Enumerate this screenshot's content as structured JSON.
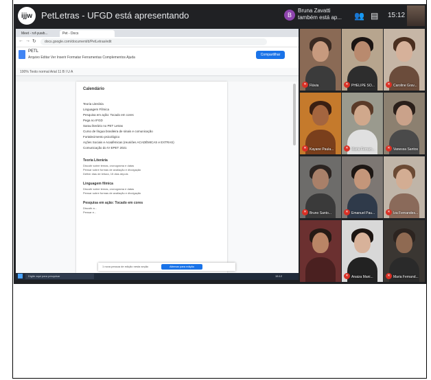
{
  "meet": {
    "logo": "ijjw",
    "title": "PetLetras - UFGD está apresentando",
    "presenter_initial": "B",
    "presenter_line1": "Bruna Zavatti",
    "presenter_line2": "também está ap...",
    "clock": "15:12",
    "icons": [
      "people-icon",
      "chat-icon"
    ]
  },
  "browser": {
    "tabs": [
      "Meet - rvf-yuwb...",
      "Pet - Docs"
    ],
    "url": "docs.google.com/document/d/PetLetras/edit",
    "doc_title": "PETL",
    "menu": "Arquivo  Editar  Ver  Inserir  Formatar  Ferramentas  Complementos  Ajuda",
    "share_label": "Compartilhar",
    "toolbar": "100%   Texto normal   Arial   11   B I U A",
    "doc": {
      "heading": "Calendário",
      "bullets": [
        "Teoria Literária",
        "Linguagem Fílmica",
        "Pesquisa em ação: Tocado em cores",
        "Pega no IFGD",
        "Sarau literário no PET Letras",
        "Curso de língua brasileira de sinais e comunicação",
        "Fortalecimento psicológico",
        "Ações Sociais e Acadêmicas (reuniões ACADÊMICAS e EXTRAS)",
        "Comunicação do IV EPET 2021"
      ],
      "section1": "Teoria Literária",
      "section1_lines": [
        "Discutir sobre temas, cronograma e datas",
        "Pensar sobre formas de avaliação e divulgação",
        "Definir dias de leitura, 15 dias depois"
      ],
      "section2": "Linguagem fílmica",
      "section2_lines": [
        "Discutir sobre temas, cronograma e datas",
        "Pensar sobre formas de avaliação e divulgação"
      ],
      "section3": "Pesquisa em ação: Tocado em cores",
      "section3_lines": [
        "Discutir a...",
        "Pensar e..."
      ]
    },
    "snackbar_text": "1 nova pessoa de edição nesta seção",
    "snackbar_button": "Alternar para edição",
    "taskbar_search": "Digite aqui para pesquisar",
    "taskbar_clock": "15:12"
  },
  "participants": [
    {
      "name": "Flávia",
      "skin": "#c79a7e",
      "hair": "#3a2a22",
      "bg": "#8a6a55",
      "shirt": "#3b3b3b"
    },
    {
      "name": "PHELIPE SO...",
      "skin": "#b98a6e",
      "hair": "#1a1412",
      "bg": "#b7a58e",
      "shirt": "#2d2d2d"
    },
    {
      "name": "Caroline Grav...",
      "skin": "#d6b19a",
      "hair": "#4a2f20",
      "bg": "#c6b6a6",
      "shirt": "#6b4c3b"
    },
    {
      "name": "Kayane Paula...",
      "skin": "#a4653f",
      "hair": "#3a1f12",
      "bg": "#c57a2c",
      "shirt": "#7a3f1c"
    },
    {
      "name": "Maria Fernan...",
      "skin": "#d0a88c",
      "hair": "#5a3a28",
      "bg": "#9a9a8e",
      "shirt": "#e0e0e0"
    },
    {
      "name": "Vanessa Santos",
      "skin": "#caa28a",
      "hair": "#2a1f1a",
      "bg": "#8c8070",
      "shirt": "#4a4a4a"
    },
    {
      "name": "Bruno Santo...",
      "skin": "#a98069",
      "hair": "#2b2421",
      "bg": "#6d6c6a",
      "shirt": "#3a3a3a"
    },
    {
      "name": "Emanuel Pau...",
      "skin": "#c4967a",
      "hair": "#1d1714",
      "bg": "#7d7773",
      "shirt": "#2f3a4a"
    },
    {
      "name": "Iza Fernandes...",
      "skin": "#d3ad93",
      "hair": "#6b4a34",
      "bg": "#c0b5a8",
      "shirt": "#8a6a5a"
    },
    {
      "name": "",
      "skin": "#b98566",
      "hair": "#241a15",
      "bg": "#6b3030",
      "shirt": "#4a2020"
    },
    {
      "name": "Anaiza Mani...",
      "skin": "#d8b29a",
      "hair": "#1c1512",
      "bg": "#d8d8d8",
      "shirt": "#222222"
    },
    {
      "name": "Maria Fernand...",
      "skin": "#8f6a52",
      "hair": "#2c2420",
      "bg": "#3a3632",
      "shirt": "#2a2a2a"
    }
  ]
}
